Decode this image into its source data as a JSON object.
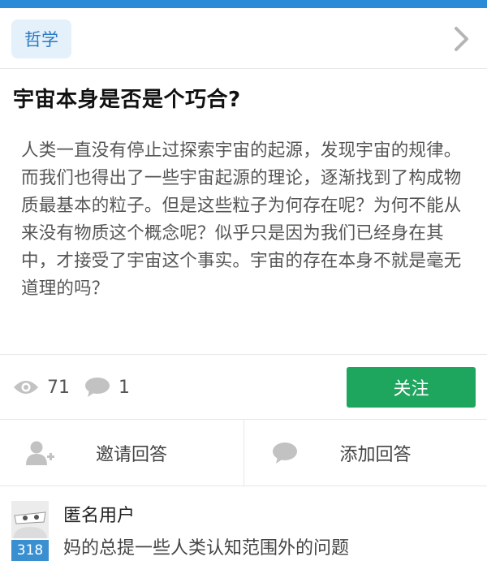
{
  "topic": {
    "tag_label": "哲学"
  },
  "question": {
    "title": "宇宙本身是否是个巧合?",
    "body": "人类一直没有停止过探索宇宙的起源，发现宇宙的规律。而我们也得出了一些宇宙起源的理论，逐渐找到了构成物质最基本的粒子。但是这些粒子为何存在呢？为何不能从来没有物质这个概念呢？似乎只是因为我们已经身在其中，才接受了宇宙这个事实。宇宙的存在本身不就是毫无道理的吗？"
  },
  "stats": {
    "views": "71",
    "comments": "1",
    "follow_label": "关注"
  },
  "actions": {
    "invite_label": "邀请回答",
    "add_answer_label": "添加回答"
  },
  "answer": {
    "author": "匿名用户",
    "vote_count": "318",
    "excerpt": "妈的总提一些人类认知范围外的问题"
  },
  "colors": {
    "top_bar": "#2a8bd6",
    "follow_button": "#1ea55e",
    "tag_bg": "#e4f0fa",
    "tag_text": "#2a7ac4",
    "vote_badge": "#3a8fd0"
  },
  "icons": {
    "chevron": "chevron-right-icon",
    "views": "eye-icon",
    "comments": "comment-bubble-icon",
    "invite": "add-user-icon",
    "add_answer": "speech-bubble-icon"
  }
}
